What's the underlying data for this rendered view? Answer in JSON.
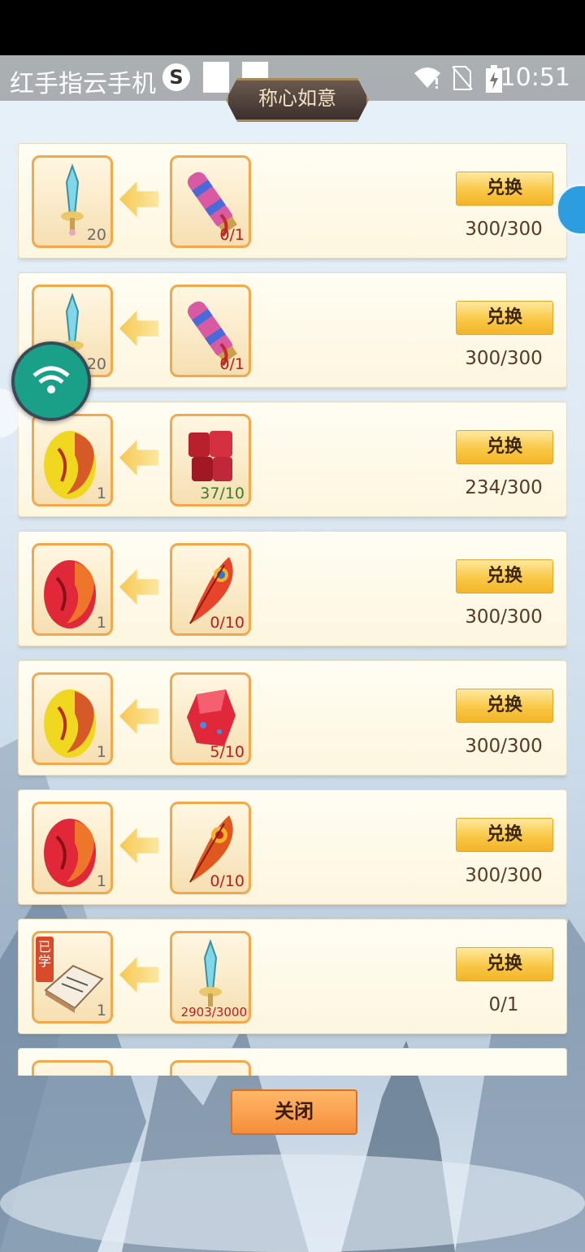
{
  "status_bar": {
    "app_name": "红手指云手机",
    "time": "10:51",
    "icons": [
      "s-logo-icon",
      "white-square-icon",
      "white-square-icon",
      "wifi-alert-icon",
      "no-sim-icon",
      "battery-charging-icon"
    ]
  },
  "panel": {
    "title": "称心如意",
    "exchange_label": "兑换",
    "close_label": "关闭"
  },
  "rows": [
    {
      "reward_icon": "sword-icon",
      "reward_count": "20",
      "cost_icon": "scroll-icon",
      "cost_count": "0/1",
      "cost_color": "red",
      "quota": "300/300"
    },
    {
      "reward_icon": "sword-icon",
      "reward_count": "20",
      "cost_icon": "scroll-icon",
      "cost_count": "0/1",
      "cost_color": "red",
      "quota": "300/300"
    },
    {
      "reward_icon": "yellow-dragon-egg-icon",
      "reward_count": "1",
      "cost_icon": "red-gem-cluster-icon",
      "cost_count": "37/10",
      "cost_color": "green",
      "quota": "234/300"
    },
    {
      "reward_icon": "red-dragon-egg-icon",
      "reward_count": "1",
      "cost_icon": "phoenix-feather-icon",
      "cost_count": "0/10",
      "cost_color": "red",
      "quota": "300/300"
    },
    {
      "reward_icon": "yellow-dragon-egg-icon",
      "reward_count": "1",
      "cost_icon": "red-crystal-icon",
      "cost_count": "5/10",
      "cost_color": "red",
      "quota": "300/300"
    },
    {
      "reward_icon": "red-dragon-egg-icon",
      "reward_count": "1",
      "cost_icon": "phoenix-feather-icon",
      "cost_count": "0/10",
      "cost_color": "red",
      "quota": "300/300"
    },
    {
      "reward_icon": "skill-book-icon",
      "reward_count": "1",
      "reward_badge": "已学",
      "cost_icon": "sword-icon",
      "cost_count": "2903/3000",
      "cost_color": "red",
      "quota": "0/1"
    }
  ],
  "colors": {
    "exchange_button": "#f9c845",
    "close_button": "#f58e3a",
    "slot_border": "#f2a84b",
    "count_red": "#c11a1a",
    "count_green": "#3c7a2c"
  }
}
